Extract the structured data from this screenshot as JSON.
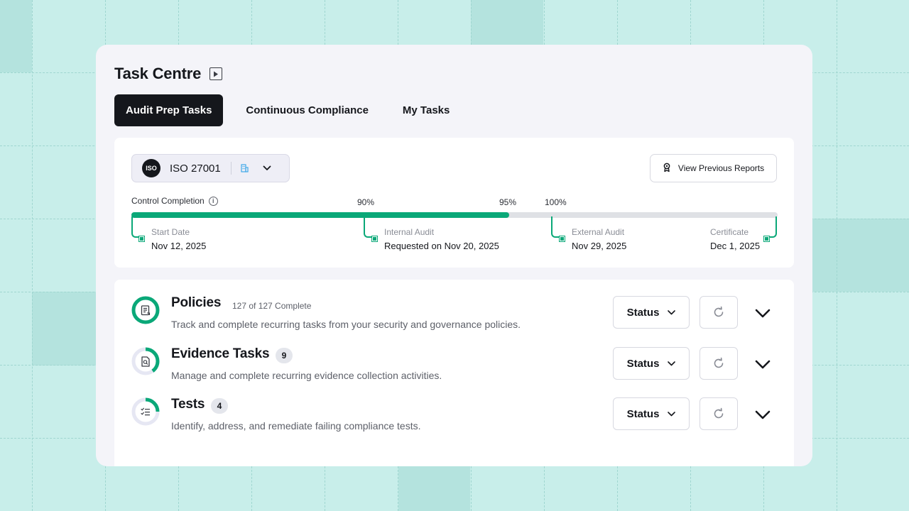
{
  "header": {
    "title": "Task Centre"
  },
  "tabs": [
    {
      "label": "Audit Prep Tasks",
      "active": true
    },
    {
      "label": "Continuous Compliance",
      "active": false
    },
    {
      "label": "My Tasks",
      "active": false
    }
  ],
  "framework": {
    "badge": "ISO",
    "name": "ISO 27001"
  },
  "reports_button": {
    "label": "View Previous Reports"
  },
  "progress": {
    "label": "Control Completion",
    "completion_fraction": 0.585,
    "markers": [
      "90%",
      "95%",
      "100%"
    ],
    "milestones": [
      {
        "label": "Start Date",
        "value": "Nov 12, 2025"
      },
      {
        "label": "Internal Audit",
        "value": "Requested on Nov 20, 2025"
      },
      {
        "label": "External Audit",
        "value": "Nov 29, 2025"
      },
      {
        "label": "Certificate",
        "value": "Dec 1, 2025"
      }
    ]
  },
  "sections": [
    {
      "title": "Policies",
      "meta": "127 of 127 Complete",
      "badge": "",
      "description": "Track and complete recurring tasks from your security and governance policies.",
      "progress_fraction": 1.0,
      "icon": "policy-document-icon",
      "status_label": "Status"
    },
    {
      "title": "Evidence Tasks",
      "meta": "",
      "badge": "9",
      "description": "Manage and complete recurring evidence collection activities.",
      "progress_fraction": 0.4,
      "icon": "evidence-search-icon",
      "status_label": "Status"
    },
    {
      "title": "Tests",
      "meta": "",
      "badge": "4",
      "description": "Identify, address, and remediate failing compliance tests.",
      "progress_fraction": 0.25,
      "icon": "checklist-icon",
      "status_label": "Status"
    }
  ],
  "colors": {
    "accent": "#0aa878",
    "dark": "#15171c",
    "background": "#c8eeea"
  }
}
